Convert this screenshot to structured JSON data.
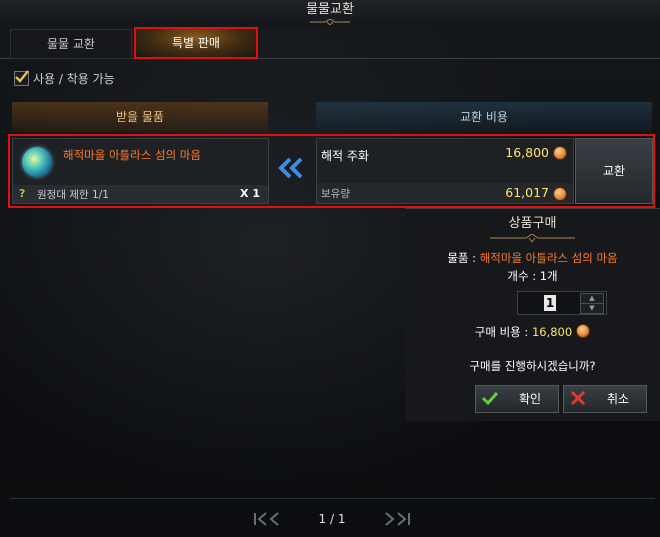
{
  "window": {
    "title": "물물교환"
  },
  "tabs": [
    {
      "label": "물물 교환",
      "active": false
    },
    {
      "label": "특별 판매",
      "active": true
    }
  ],
  "filter": {
    "label": "사용 / 착용 가능",
    "checked": true
  },
  "headers": {
    "receive": "받을 물품",
    "cost": "교환 비용"
  },
  "item": {
    "name": "해적마을 아틀라스 섬의 마음",
    "limit": "원정대 제한 1/1",
    "quantity": "X 1",
    "cost_name": "해적 주화",
    "cost_value": "16,800",
    "owned_label": "보유량",
    "owned_value": "61,017",
    "exchange_label": "교환"
  },
  "purchase": {
    "title": "상품구매",
    "item_prefix": "물품 : ",
    "item_name": "해적마을 아틀라스 섬의 마음",
    "count": "개수 : 1개",
    "stepper_value": "1",
    "cost_prefix": "구매 비용 : ",
    "cost_value": "16,800",
    "question": "구매를 진행하시겠습니까?",
    "confirm_label": "확인",
    "cancel_label": "취소"
  },
  "pager": {
    "text": "1 / 1"
  },
  "colors": {
    "orange_name": "#ff7a2a",
    "gold_value": "#ffe46a",
    "highlight": "#e01010"
  }
}
